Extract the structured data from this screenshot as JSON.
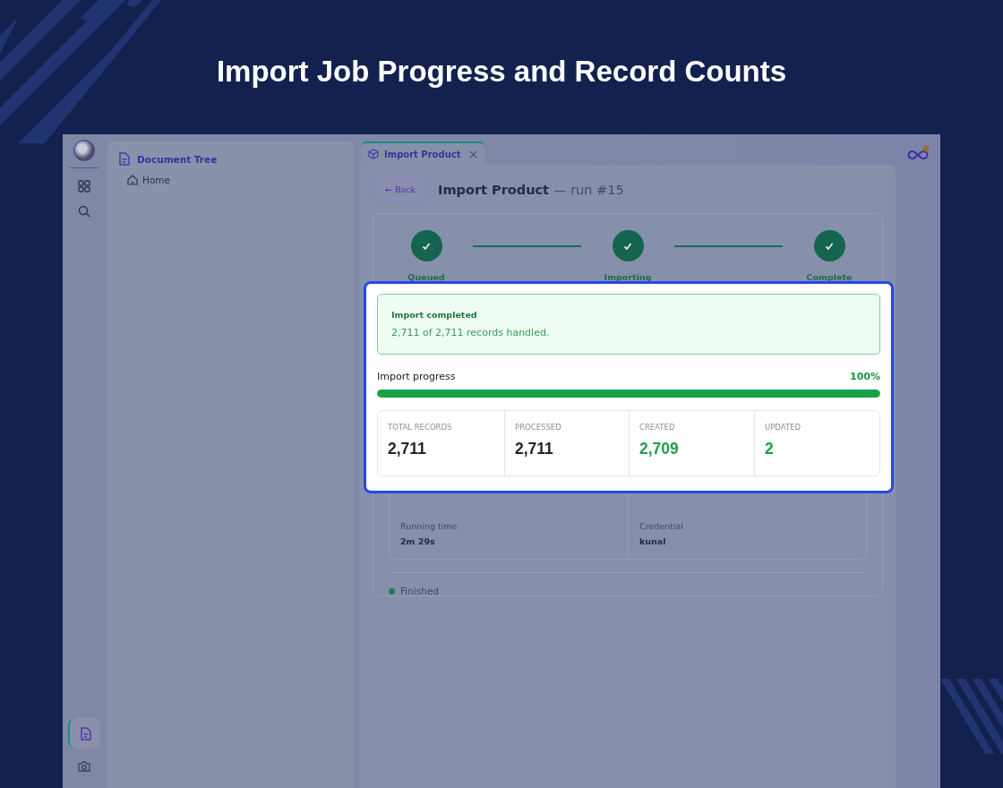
{
  "headline": "Import Job Progress and Record Counts",
  "rail_top": [
    {
      "kind": "apps",
      "selected": false
    },
    {
      "kind": "search",
      "selected": false
    }
  ],
  "rail_bottom": [
    {
      "kind": "document",
      "selected": true
    },
    {
      "kind": "camera",
      "selected": false
    }
  ],
  "sidebar": {
    "title": "Document Tree",
    "items": [
      {
        "label": "Home"
      }
    ]
  },
  "tabs": [
    {
      "label": "Import Product",
      "selected": true
    }
  ],
  "page": {
    "back": "← Back",
    "title": "Import Product",
    "subtitle": "— run #15"
  },
  "steps": [
    {
      "label": "Queued",
      "done": true
    },
    {
      "label": "Importing",
      "done": true
    },
    {
      "label": "Complete",
      "done": true
    }
  ],
  "result": {
    "title": "Import completed",
    "message": "2,711 of 2,711 records handled.",
    "progress_label": "Import progress",
    "progress_value": "100%",
    "level": 1,
    "stats": [
      {
        "label": "TOTAL RECORDS",
        "value": "2,711",
        "kind": "neutral"
      },
      {
        "label": "PROCESSED",
        "value": "2,711",
        "kind": "neutral"
      },
      {
        "label": "CREATED",
        "value": "2,709",
        "kind": "success"
      },
      {
        "label": "UPDATED",
        "value": "2",
        "kind": "success"
      }
    ]
  },
  "details": [
    {
      "label": "Running time",
      "value": "2m 29s"
    },
    {
      "label": "Credential",
      "value": "kunal"
    }
  ],
  "status": {
    "label": "Finished",
    "color": "#1d7a5a"
  }
}
